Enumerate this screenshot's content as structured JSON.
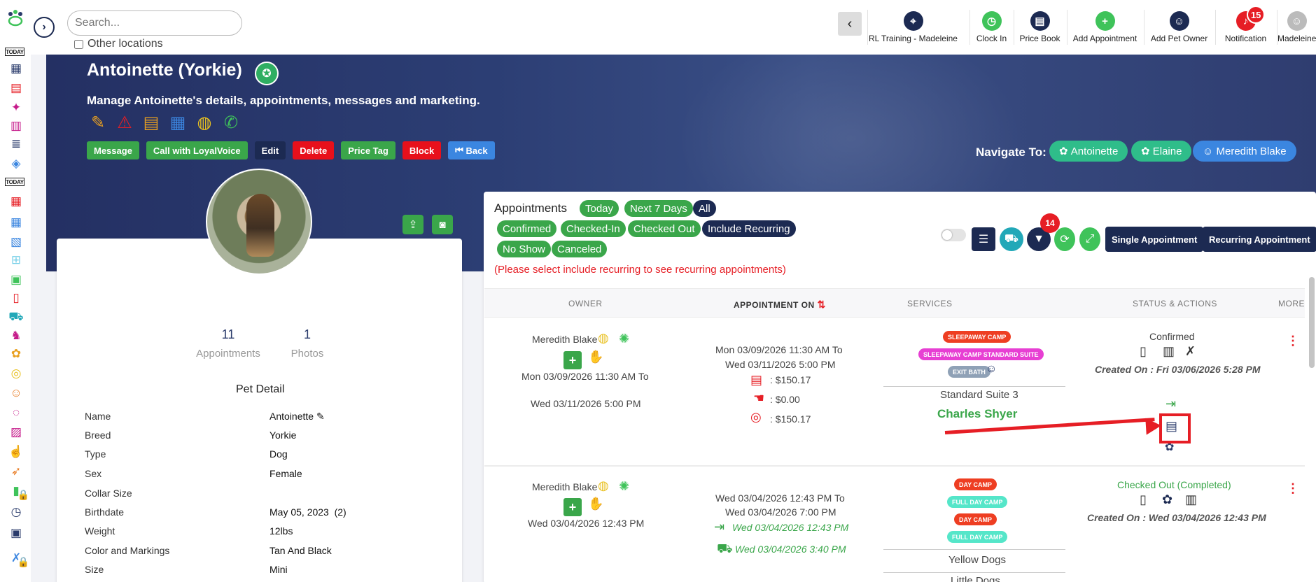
{
  "search": {
    "placeholder": "Search...",
    "other_locations": "Other locations"
  },
  "toolbar": [
    {
      "label": "RL Training - Madeleine",
      "icon": "map-pin-icon",
      "color": "#1c2a52"
    },
    {
      "label": "Clock In",
      "icon": "clock-icon",
      "color": "#3fc35a"
    },
    {
      "label": "Price Book",
      "icon": "book-icon",
      "color": "#1c2a52"
    },
    {
      "label": "Add Appointment",
      "icon": "calendar-plus-icon",
      "color": "#3fc35a"
    },
    {
      "label": "Add Pet Owner",
      "icon": "user-plus-icon",
      "color": "#1c2a52"
    },
    {
      "label": "Notification",
      "icon": "bell-icon",
      "color": "#e61e25",
      "badge": "15"
    },
    {
      "label": "Madeleine",
      "icon": "avatar-icon",
      "color": "#bbbbbb"
    }
  ],
  "hero": {
    "title": "Antoinette (Yorkie)",
    "subtitle": "Manage Antoinette's details, appointments, messages and marketing.",
    "actions": [
      "Message",
      "Call with LoyalVoice",
      "Edit",
      "Delete",
      "Price Tag",
      "Block",
      "Back"
    ],
    "navigate_label": "Navigate To:",
    "navigate": [
      "Antoinette",
      "Elaine",
      "Meredith Blake"
    ]
  },
  "pet": {
    "stats": [
      {
        "num": "11",
        "cap": "Appointments"
      },
      {
        "num": "1",
        "cap": "Photos"
      }
    ],
    "detail_heading": "Pet Detail",
    "details": [
      {
        "k": "Name",
        "v": "Antoinette"
      },
      {
        "k": "Breed",
        "v": "Yorkie"
      },
      {
        "k": "Type",
        "v": "Dog"
      },
      {
        "k": "Sex",
        "v": "Female"
      },
      {
        "k": "Collar Size",
        "v": ""
      },
      {
        "k": "Birthdate",
        "v": "May 05, 2023  (2)"
      },
      {
        "k": "Weight",
        "v": "12lbs"
      },
      {
        "k": "Color and Markings",
        "v": "Tan And Black"
      },
      {
        "k": "Size",
        "v": "Mini"
      }
    ]
  },
  "appointments": {
    "heading": "Appointments",
    "filters_row1": [
      "Today",
      "Next 7 Days",
      "All"
    ],
    "filters_row2": [
      "Confirmed",
      "Checked-In",
      "Checked Out",
      "Include Recurring"
    ],
    "filters_row3": [
      "No Show",
      "Canceled"
    ],
    "notice": "(Please select include recurring to see recurring appointments)",
    "filter_badge": "14",
    "single_btn": "Single Appointment",
    "recurring_btn": "Recurring Appointment",
    "columns": [
      "OWNER",
      "APPOINTMENT ON",
      "SERVICES",
      "STATUS & ACTIONS",
      "MORE"
    ],
    "rows": [
      {
        "owner": "Meredith Blake",
        "owner_from": "Mon 03/09/2026 11:30 AM To",
        "owner_to": "Wed 03/11/2026 5:00 PM",
        "appt_line1": "Mon 03/09/2026 11:30 AM To",
        "appt_line2": "Wed 03/11/2026 5:00 PM",
        "amount1": ": $150.17",
        "amount2": ": $0.00",
        "amount3": ": $150.17",
        "tags": [
          "SLEEPAWAY CAMP",
          "SLEEPAWAY CAMP STANDARD SUITE",
          "EXIT BATH"
        ],
        "room": "Standard Suite 3",
        "staff": "Charles Shyer",
        "status": "Confirmed",
        "created": "Created On : Fri 03/06/2026 5:28 PM"
      },
      {
        "owner": "Meredith Blake",
        "owner_from": "Wed 03/04/2026 12:43 PM",
        "appt_line1": "Wed 03/04/2026 12:43 PM To",
        "appt_line2": "Wed 03/04/2026 7:00 PM",
        "checkin": "Wed 03/04/2026 12:43 PM",
        "checkout": "Wed 03/04/2026 3:40 PM",
        "tags": [
          "DAY CAMP",
          "FULL DAY CAMP",
          "DAY CAMP",
          "FULL DAY CAMP"
        ],
        "room": "Yellow Dogs",
        "room2": "Little Dogs",
        "status": "Checked Out (Completed)",
        "created": "Created On : Wed 03/04/2026 12:43 PM"
      }
    ]
  }
}
